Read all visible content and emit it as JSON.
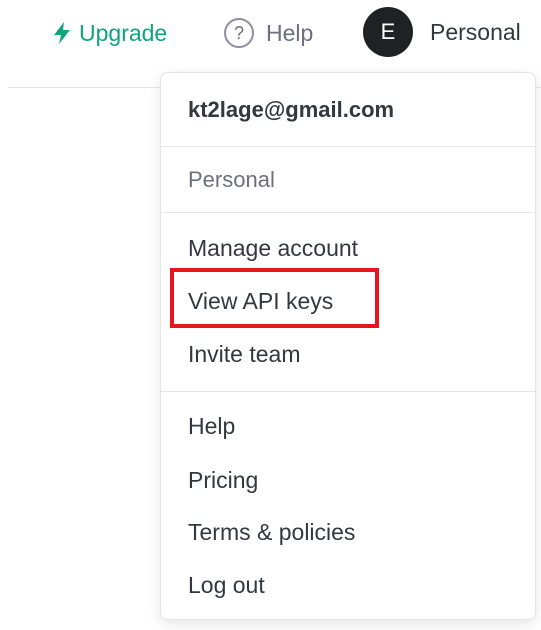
{
  "header": {
    "upgrade_label": "Upgrade",
    "help_label": "Help",
    "help_icon_glyph": "?",
    "avatar_initial": "E",
    "account_label": "Personal"
  },
  "menu": {
    "email": "kt2lage@gmail.com",
    "organization": "Personal",
    "account_items": [
      "Manage account",
      "View API keys",
      "Invite team"
    ],
    "support_items": [
      "Help",
      "Pricing",
      "Terms & policies",
      "Log out"
    ]
  },
  "colors": {
    "accent_green": "#10a37f",
    "avatar_bg": "#202123",
    "highlight_red": "#e8141e"
  },
  "icons": {
    "upgrade": "lightning-bolt-icon",
    "help": "question-circle-icon"
  }
}
